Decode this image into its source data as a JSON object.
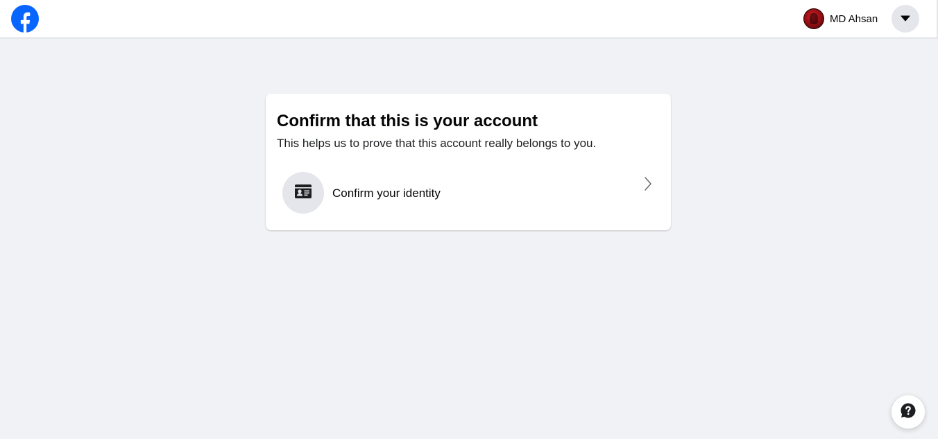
{
  "header": {
    "logo_icon": "facebook-logo-icon",
    "brand_color": "#0866ff",
    "profile": {
      "name": "MD Ahsan",
      "avatar_icon": "user-avatar"
    },
    "menu_icon": "caret-down-icon"
  },
  "card": {
    "title": "Confirm that this is your account",
    "subtitle": "This helps us to prove that this account really belongs to you.",
    "option": {
      "label": "Confirm your identity",
      "icon": "id-card-icon",
      "chevron_icon": "chevron-right-icon"
    }
  },
  "help": {
    "icon": "question-mark-icon"
  },
  "colors": {
    "page_background": "#f0f2f5",
    "card_background": "#ffffff",
    "icon_circle": "#e4e6eb"
  }
}
